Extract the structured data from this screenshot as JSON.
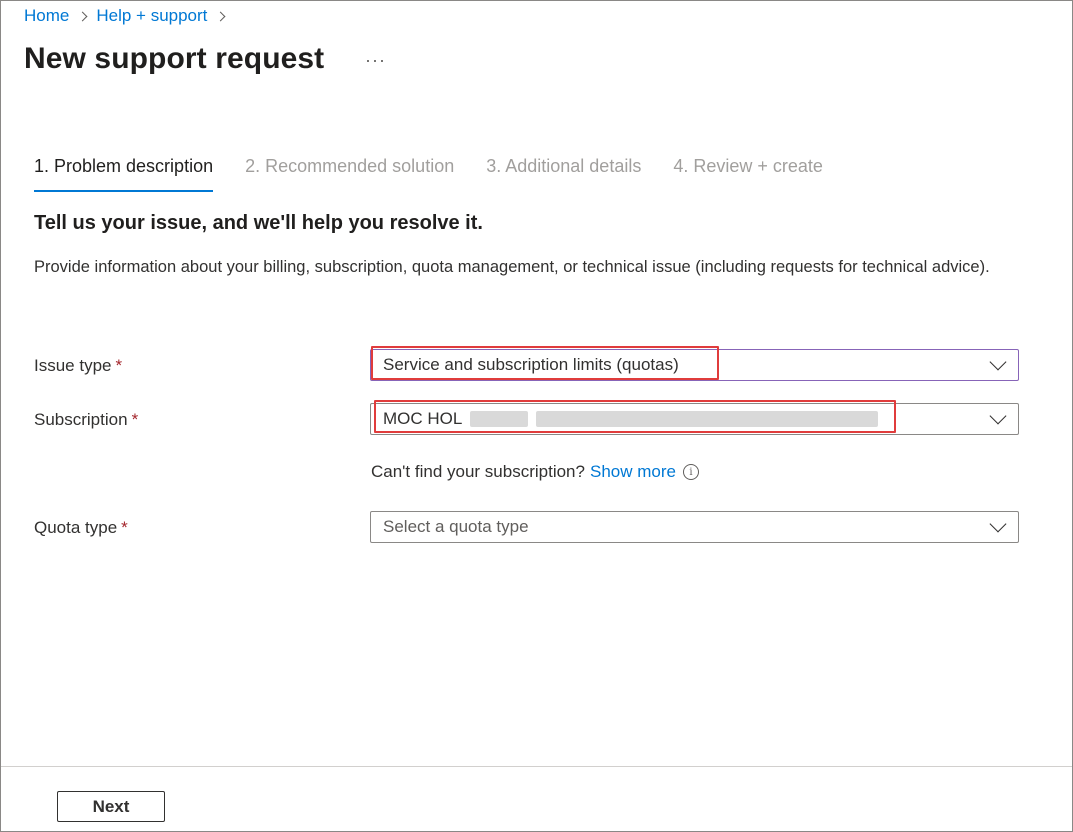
{
  "breadcrumb": {
    "home": "Home",
    "help_support": "Help + support"
  },
  "page": {
    "title": "New support request",
    "more": "···"
  },
  "tabs": [
    {
      "label": "1. Problem description",
      "active": true
    },
    {
      "label": "2. Recommended solution",
      "active": false
    },
    {
      "label": "3. Additional details",
      "active": false
    },
    {
      "label": "4. Review + create",
      "active": false
    }
  ],
  "section": {
    "heading": "Tell us your issue, and we'll help you resolve it.",
    "description": "Provide information about your billing, subscription, quota management, or technical issue (including requests for technical advice)."
  },
  "form": {
    "issue_type": {
      "label": "Issue type",
      "required_mark": "*",
      "value": "Service and subscription limits (quotas)"
    },
    "subscription": {
      "label": "Subscription",
      "required_mark": "*",
      "value": "MOC HOL"
    },
    "subscription_helper": {
      "text": "Can't find your subscription?",
      "link": "Show more",
      "info_glyph": "i"
    },
    "quota_type": {
      "label": "Quota type",
      "required_mark": "*",
      "placeholder": "Select a quota type"
    }
  },
  "footer": {
    "next_label": "Next"
  },
  "colors": {
    "accent": "#0078d4",
    "highlight": "#e03c3c",
    "required": "#a4262c"
  }
}
